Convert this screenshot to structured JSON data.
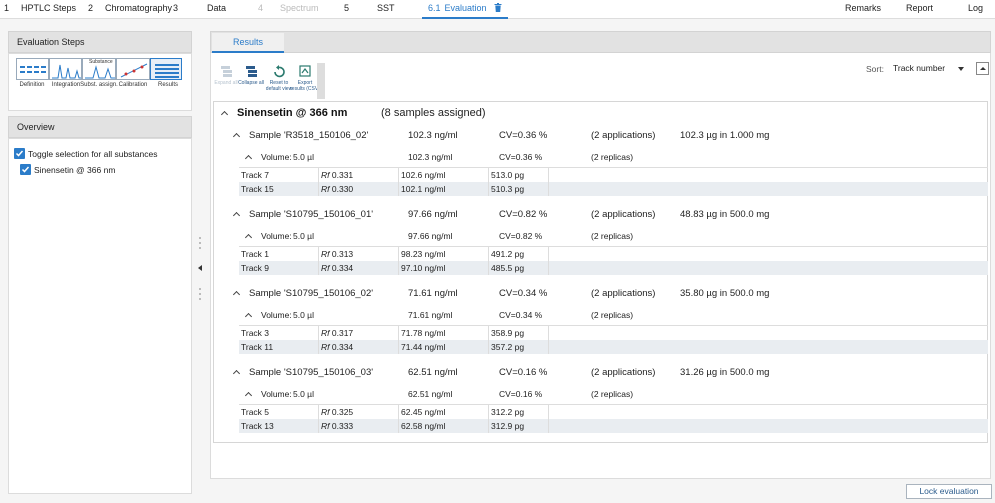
{
  "nav": {
    "steps": [
      {
        "num": "1",
        "label": "HPTLC Steps",
        "state": "normal"
      },
      {
        "num": "2",
        "label": "Chromatography",
        "state": "normal"
      },
      {
        "num": "3",
        "label": "Data",
        "state": "normal"
      },
      {
        "num": "4",
        "label": "Spectrum",
        "state": "disabled"
      },
      {
        "num": "5",
        "label": "SST",
        "state": "normal"
      },
      {
        "num": "6.1",
        "label": "Evaluation",
        "state": "active"
      }
    ],
    "right": [
      "Remarks",
      "Report",
      "Log"
    ]
  },
  "left": {
    "evaluation_steps_title": "Evaluation Steps",
    "step_icon_text": "Substance",
    "step_labels": [
      "Definition",
      "Integration",
      "Subst. assign.",
      "Calibration",
      "Results"
    ],
    "overview_title": "Overview",
    "toggle_all_label": "Toggle selection for all substances",
    "substance_item_label": "Sinensetin @ 366 nm"
  },
  "right": {
    "tab": "Results",
    "toolbar": [
      {
        "label": "Expand all",
        "enabled": false
      },
      {
        "label": "Collapse all",
        "enabled": true
      },
      {
        "label": "Reset to default view",
        "enabled": true
      },
      {
        "label": "Export results (CSV)",
        "enabled": true
      }
    ],
    "sort_label": "Sort:",
    "sort_value": "Track number"
  },
  "results": {
    "substance": "Sinensetin @ 366 nm",
    "assigned": "(8 samples assigned)",
    "samples": [
      {
        "name": "Sample 'R3518_150106_02'",
        "conc": "102.3 ng/ml",
        "cv": "CV=0.36 %",
        "apps": "(2 applications)",
        "amount": "102.3 µg in 1.000 mg",
        "volume_label": "Volume:",
        "volume": "5.0 µl",
        "vconc": "102.3 ng/ml",
        "vcv": "CV=0.36 %",
        "replicas": "(2 replicas)",
        "tracks": [
          {
            "track": "Track 7",
            "rf_label": "Rf",
            "rf": "0.331",
            "conc": "102.6 ng/ml",
            "amount": "513.0 pg"
          },
          {
            "track": "Track 15",
            "rf_label": "Rf",
            "rf": "0.330",
            "conc": "102.1 ng/ml",
            "amount": "510.3 pg"
          }
        ]
      },
      {
        "name": "Sample 'S10795_150106_01'",
        "conc": "97.66 ng/ml",
        "cv": "CV=0.82 %",
        "apps": "(2 applications)",
        "amount": "48.83 µg in 500.0 mg",
        "volume_label": "Volume:",
        "volume": "5.0 µl",
        "vconc": "97.66 ng/ml",
        "vcv": "CV=0.82 %",
        "replicas": "(2 replicas)",
        "tracks": [
          {
            "track": "Track 1",
            "rf_label": "Rf",
            "rf": "0.313",
            "conc": "98.23 ng/ml",
            "amount": "491.2 pg"
          },
          {
            "track": "Track 9",
            "rf_label": "Rf",
            "rf": "0.334",
            "conc": "97.10 ng/ml",
            "amount": "485.5 pg"
          }
        ]
      },
      {
        "name": "Sample 'S10795_150106_02'",
        "conc": "71.61 ng/ml",
        "cv": "CV=0.34 %",
        "apps": "(2 applications)",
        "amount": "35.80 µg in 500.0 mg",
        "volume_label": "Volume:",
        "volume": "5.0 µl",
        "vconc": "71.61 ng/ml",
        "vcv": "CV=0.34 %",
        "replicas": "(2 replicas)",
        "tracks": [
          {
            "track": "Track 3",
            "rf_label": "Rf",
            "rf": "0.317",
            "conc": "71.78 ng/ml",
            "amount": "358.9 pg"
          },
          {
            "track": "Track 11",
            "rf_label": "Rf",
            "rf": "0.334",
            "conc": "71.44 ng/ml",
            "amount": "357.2 pg"
          }
        ]
      },
      {
        "name": "Sample 'S10795_150106_03'",
        "conc": "62.51 ng/ml",
        "cv": "CV=0.16 %",
        "apps": "(2 applications)",
        "amount": "31.26 µg in 500.0 mg",
        "volume_label": "Volume:",
        "volume": "5.0 µl",
        "vconc": "62.51 ng/ml",
        "vcv": "CV=0.16 %",
        "replicas": "(2 replicas)",
        "tracks": [
          {
            "track": "Track 5",
            "rf_label": "Rf",
            "rf": "0.325",
            "conc": "62.45 ng/ml",
            "amount": "312.2 pg"
          },
          {
            "track": "Track 13",
            "rf_label": "Rf",
            "rf": "0.333",
            "conc": "62.58 ng/ml",
            "amount": "312.9 pg"
          }
        ]
      }
    ]
  },
  "footer": {
    "lock_label": "Lock evaluation"
  },
  "colors": {
    "accent": "#2b7cc9",
    "row_alt": "#e9edf1",
    "panel_header": "#e2e2e2"
  }
}
